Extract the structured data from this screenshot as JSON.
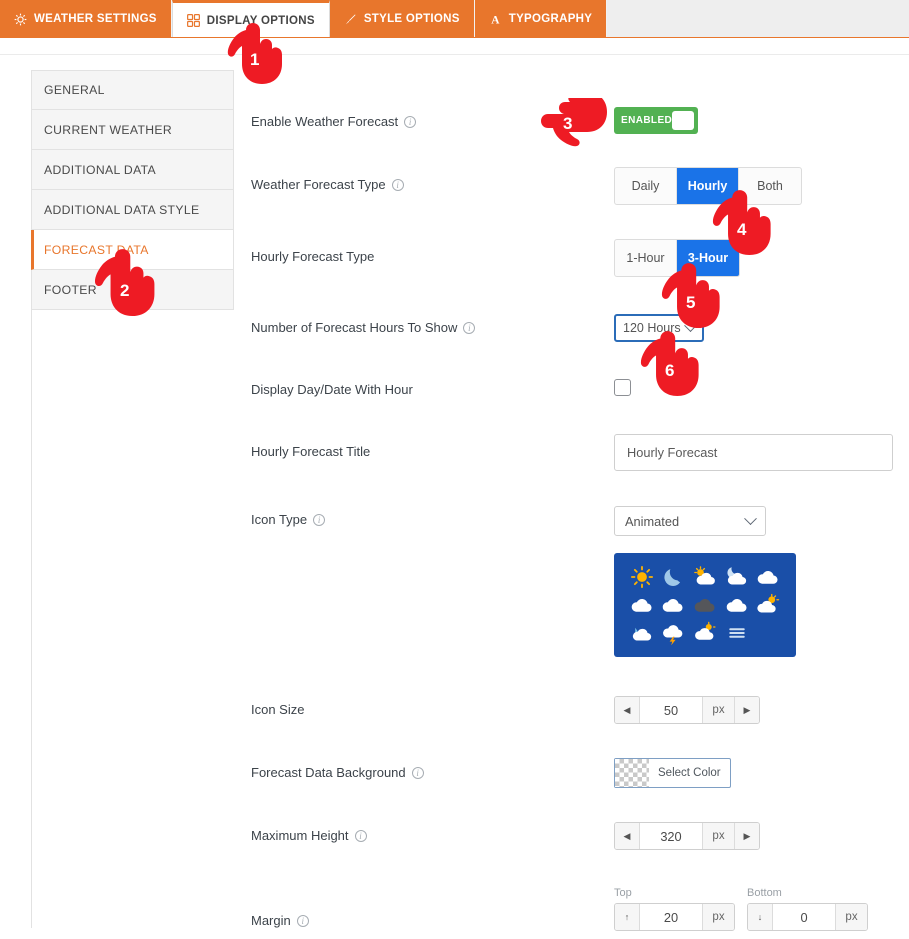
{
  "tabs": [
    {
      "label": "WEATHER SETTINGS",
      "icon": "cloud-gear-icon",
      "active": false
    },
    {
      "label": "DISPLAY OPTIONS",
      "icon": "grid-icon",
      "active": true
    },
    {
      "label": "STYLE OPTIONS",
      "icon": "brush-icon",
      "active": false
    },
    {
      "label": "TYPOGRAPHY",
      "icon": "letter-a-icon",
      "active": false
    }
  ],
  "sidebar": {
    "items": [
      {
        "label": "GENERAL",
        "active": false
      },
      {
        "label": "CURRENT WEATHER",
        "active": false
      },
      {
        "label": "ADDITIONAL DATA",
        "active": false
      },
      {
        "label": "ADDITIONAL DATA STYLE",
        "active": false
      },
      {
        "label": "FORECAST DATA",
        "active": true
      },
      {
        "label": "FOOTER",
        "active": false
      }
    ]
  },
  "form": {
    "enable_forecast": {
      "label": "Enable Weather Forecast",
      "has_info": true,
      "toggle_text": "ENABLED",
      "state": "on"
    },
    "forecast_type": {
      "label": "Weather Forecast Type",
      "has_info": true,
      "options": [
        "Daily",
        "Hourly",
        "Both"
      ],
      "selected": "Hourly"
    },
    "hourly_type": {
      "label": "Hourly Forecast Type",
      "has_info": false,
      "options": [
        "1-Hour",
        "3-Hour"
      ],
      "selected": "3-Hour"
    },
    "hours_to_show": {
      "label": "Number of Forecast Hours To Show",
      "has_info": true,
      "value": "120 Hours"
    },
    "display_day_date": {
      "label": "Display Day/Date With Hour",
      "has_info": false,
      "checked": false
    },
    "hourly_title": {
      "label": "Hourly Forecast Title",
      "has_info": false,
      "value": "Hourly Forecast"
    },
    "icon_type": {
      "label": "Icon Type",
      "has_info": true,
      "value": "Animated"
    },
    "icon_preview": {
      "background": "#1a4fa8",
      "icons": [
        "sun-icon",
        "moon-icon",
        "sun-cloud-icon",
        "moon-cloud-icon",
        "cloud-icon",
        "cloud-icon",
        "cloud-icon",
        "dark-cloud-icon",
        "cloud-icon",
        "sun-cloud-icon",
        "rain-cloud-icon",
        "thunderstorm-icon",
        "sun-cloud-rain-icon",
        "fog-icon"
      ]
    },
    "icon_size": {
      "label": "Icon Size",
      "has_info": false,
      "value": "50",
      "unit": "px"
    },
    "forecast_bg": {
      "label": "Forecast Data Background",
      "has_info": true,
      "button_label": "Select Color",
      "swatch": "transparent"
    },
    "max_height": {
      "label": "Maximum Height",
      "has_info": true,
      "value": "320",
      "unit": "px"
    },
    "margin": {
      "label": "Margin",
      "has_info": true,
      "top_label": "Top",
      "top_value": "20",
      "top_unit": "px",
      "bottom_label": "Bottom",
      "bottom_value": "0",
      "bottom_unit": "px"
    }
  },
  "markers": [
    {
      "number": "1",
      "target": "display-options-tab",
      "direction": "down"
    },
    {
      "number": "2",
      "target": "forecast-data-sidebar-item",
      "direction": "down"
    },
    {
      "number": "3",
      "target": "enable-forecast-toggle",
      "direction": "right"
    },
    {
      "number": "4",
      "target": "hourly-segment",
      "direction": "down"
    },
    {
      "number": "5",
      "target": "3-hour-segment",
      "direction": "down"
    },
    {
      "number": "6",
      "target": "hours-dropdown",
      "direction": "down"
    }
  ],
  "colors": {
    "brand_orange": "#e8762c",
    "accent_blue": "#1a73e8",
    "toggle_green": "#52b152",
    "marker_red": "#ee1b24",
    "icon_panel_blue": "#1a4fa8"
  }
}
